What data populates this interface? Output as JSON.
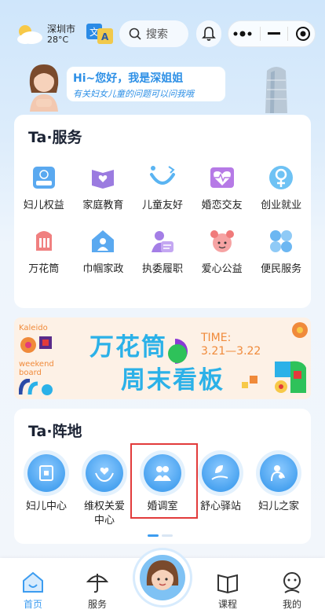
{
  "header": {
    "city": "深圳市",
    "temperature": "28°C",
    "search_placeholder": "搜索"
  },
  "greeting": {
    "line1": "Hi~您好，我是深姐姐",
    "line2": "有关妇女儿童的问题可以问我哦"
  },
  "services": {
    "title": "Ta·服务",
    "items": [
      {
        "label": "妇儿权益",
        "icon": "badge-12338-icon"
      },
      {
        "label": "家庭教育",
        "icon": "book-heart-icon"
      },
      {
        "label": "儿童友好",
        "icon": "smile-icon"
      },
      {
        "label": "婚恋交友",
        "icon": "heart-pulse-icon"
      },
      {
        "label": "创业就业",
        "icon": "female-symbol-icon"
      },
      {
        "label": "万花筒",
        "icon": "kaleidoscope-icon"
      },
      {
        "label": "巾帼家政",
        "icon": "home-person-icon"
      },
      {
        "label": "执委履职",
        "icon": "person-card-icon"
      },
      {
        "label": "爱心公益",
        "icon": "girl-face-icon"
      },
      {
        "label": "便民服务",
        "icon": "flower-icon"
      }
    ]
  },
  "banner": {
    "kaleido": "Kaleido",
    "weekend": "weekend",
    "board": "board",
    "title1": "万花筒",
    "title2": "周末看板",
    "time_label": "TIME:",
    "time_range": "3.21—3.22"
  },
  "zhendi": {
    "title": "Ta·阵地",
    "items": [
      {
        "label": "妇儿中心",
        "icon": "center-icon"
      },
      {
        "label": "维权关爱中心",
        "icon": "care-hands-icon"
      },
      {
        "label": "婚调室",
        "icon": "couple-icon"
      },
      {
        "label": "舒心驿站",
        "icon": "leaf-hand-icon"
      },
      {
        "label": "妇儿之家",
        "icon": "mother-child-icon"
      }
    ]
  },
  "tabbar": {
    "home": "首页",
    "course_service": "服务",
    "course": "课程",
    "mine": "我的"
  },
  "colors": {
    "accent": "#3c9cf0",
    "banner_text": "#2bb1e8",
    "banner_orange": "#f08a3a",
    "highlight": "#e23b3b"
  }
}
